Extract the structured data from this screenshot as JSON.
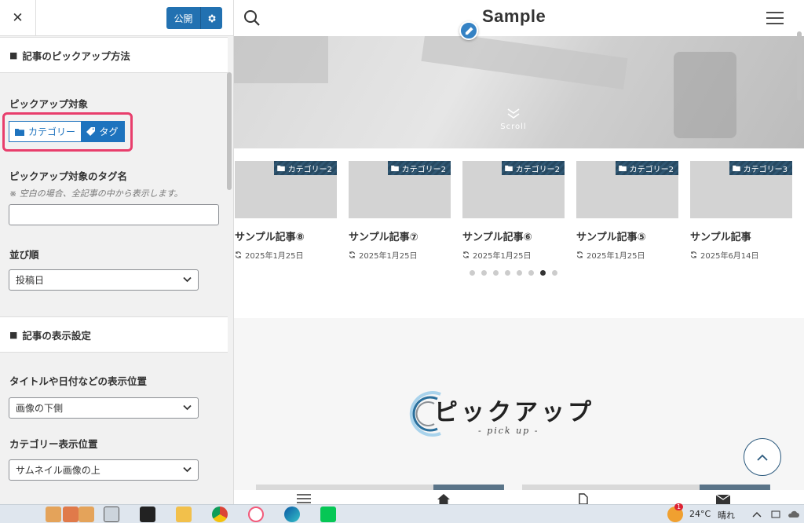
{
  "customizer": {
    "close_icon": "close-icon",
    "publish_label": "公開",
    "publish_settings_icon": "gear-icon",
    "section1_title": "記事のピックアップ方法",
    "pickup_target_label": "ピックアップ対象",
    "pickup_options": [
      {
        "label": "カテゴリー",
        "icon": "folder-icon",
        "selected": false
      },
      {
        "label": "タグ",
        "icon": "tag-icon",
        "selected": true
      }
    ],
    "tag_name_label": "ピックアップ対象のタグ名",
    "tag_name_note": "※ 空白の場合、全記事の中から表示します。",
    "tag_name_value": "",
    "order_label": "並び順",
    "order_value": "投稿日",
    "section2_title": "記事の表示設定",
    "position_label": "タイトルや日付などの表示位置",
    "position_value": "画像の下側",
    "category_position_label": "カテゴリー表示位置",
    "category_position_value": "サムネイル画像の上",
    "section_marker": "■"
  },
  "preview": {
    "site_title": "Sample",
    "scroll_label": "Scroll",
    "cards": [
      {
        "category": "カテゴリー2",
        "title": "サンプル記事⑧",
        "date": "2025年1月25日"
      },
      {
        "category": "カテゴリー2",
        "title": "サンプル記事⑦",
        "date": "2025年1月25日"
      },
      {
        "category": "カテゴリー2",
        "title": "サンプル記事⑥",
        "date": "2025年1月25日"
      },
      {
        "category": "カテゴリー2",
        "title": "サンプル記事⑤",
        "date": "2025年1月25日"
      },
      {
        "category": "カテゴリー3",
        "title": "サンプル記事",
        "date": "2025年6月14日"
      }
    ],
    "slider_dots_total": 8,
    "slider_dot_active_index": 6,
    "pickup_heading": "ピックアップ",
    "pickup_subheading": "- pick up -"
  },
  "taskbar": {
    "temperature": "24°C",
    "weather": "晴れ",
    "notification_badge": "1"
  },
  "colors": {
    "accent": "#1e73be",
    "publish": "#2271b1",
    "highlight": "#e83e6c",
    "badge": "#274961"
  }
}
